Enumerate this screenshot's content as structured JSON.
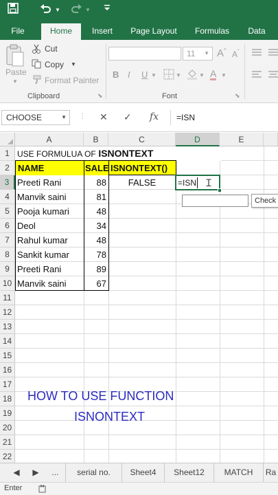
{
  "colors": {
    "excel_green": "#217346",
    "header_fill": "#ffff00",
    "overlay_text": "#2a2abf"
  },
  "quick_access": {
    "save_icon": "save-icon",
    "undo_icon": "undo-icon",
    "redo_icon": "redo-icon",
    "customize_icon": "customize-qat-icon"
  },
  "ribbon_tabs": [
    {
      "label": "File",
      "active": false
    },
    {
      "label": "Home",
      "active": true
    },
    {
      "label": "Insert",
      "active": false
    },
    {
      "label": "Page Layout",
      "active": false
    },
    {
      "label": "Formulas",
      "active": false
    },
    {
      "label": "Data",
      "active": false
    }
  ],
  "clipboard": {
    "paste": "Paste",
    "cut": "Cut",
    "copy": "Copy",
    "format_painter": "Format Painter",
    "group_label": "Clipboard"
  },
  "font_group": {
    "size": "11",
    "bold": "B",
    "italic": "I",
    "underline": "U",
    "grow": "A",
    "shrink": "A",
    "font_color": "A",
    "group_label": "Font"
  },
  "formula_bar": {
    "name_box": "CHOOSE",
    "cancel": "✕",
    "enter": "✓",
    "fx": "fx",
    "content": "=ISN"
  },
  "columns": [
    "A",
    "B",
    "C",
    "D",
    "E"
  ],
  "rows": [
    "1",
    "2",
    "3",
    "4",
    "5",
    "6",
    "7",
    "8",
    "9",
    "10",
    "11",
    "12",
    "13",
    "14",
    "15",
    "16",
    "17",
    "18",
    "19",
    "20",
    "21",
    "22"
  ],
  "sheet": {
    "title_prefix": "USE FORMULUA OF",
    "title_main": "ISNONTEXT",
    "headers": [
      "NAME",
      "SALE",
      "ISNONTEXT()"
    ],
    "data": [
      {
        "name": "Preeti Rani",
        "sale": "88"
      },
      {
        "name": "Manvik saini",
        "sale": "81"
      },
      {
        "name": "Pooja kumari",
        "sale": "48"
      },
      {
        "name": "Deol",
        "sale": "34"
      },
      {
        "name": "Rahul kumar",
        "sale": "48"
      },
      {
        "name": "Sankit kumar",
        "sale": "78"
      },
      {
        "name": "Preeti Rani",
        "sale": "89"
      },
      {
        "name": "Manvik saini",
        "sale": "67"
      }
    ],
    "c3_value": "FALSE",
    "d3_editing": "=ISN",
    "tooltip": "Check"
  },
  "overlay": {
    "line1": "HOW TO USE FUNCTION",
    "line2": "ISNONTEXT"
  },
  "sheet_tabs": {
    "ellipsis": "...",
    "tabs": [
      "serial no.",
      "Sheet4",
      "Sheet12",
      "MATCH",
      "Ra"
    ]
  },
  "status": {
    "mode": "Enter"
  }
}
